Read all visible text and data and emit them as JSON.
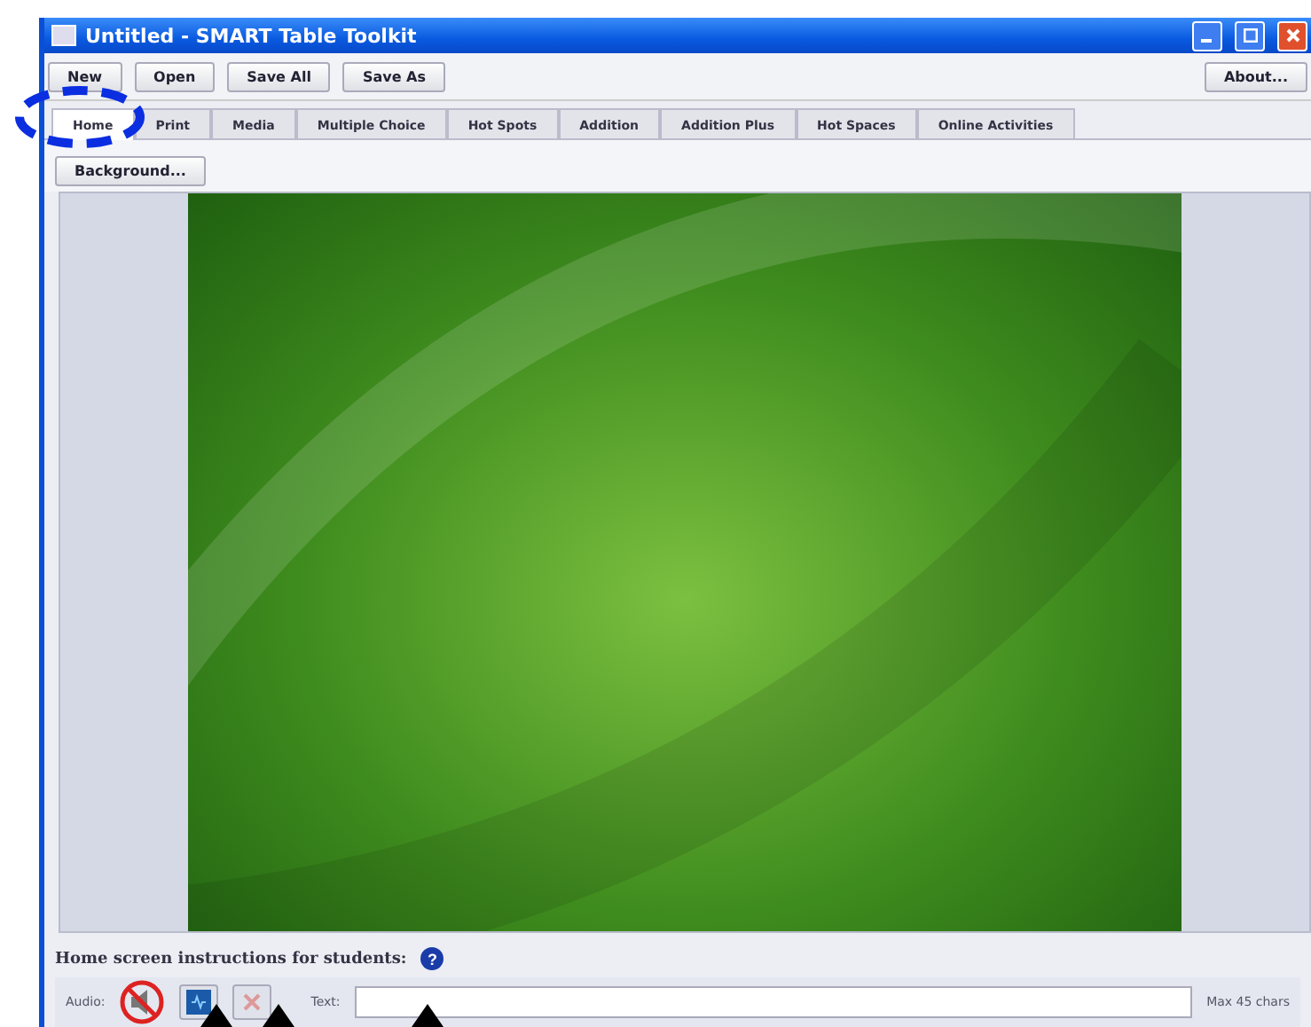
{
  "window": {
    "title": "Untitled - SMART Table Toolkit"
  },
  "toolbar": {
    "buttons": [
      "New",
      "Open",
      "Save All",
      "Save As"
    ],
    "about": "About..."
  },
  "tabs": [
    {
      "label": "Home",
      "selected": true
    },
    {
      "label": "Print",
      "selected": false
    },
    {
      "label": "Media",
      "selected": false
    },
    {
      "label": "Multiple Choice",
      "selected": false
    },
    {
      "label": "Hot Spots",
      "selected": false
    },
    {
      "label": "Addition",
      "selected": false
    },
    {
      "label": "Addition Plus",
      "selected": false
    },
    {
      "label": "Hot Spaces",
      "selected": false
    },
    {
      "label": "Online Activities",
      "selected": false
    }
  ],
  "background_button": "Background...",
  "instructions": {
    "heading": "Home screen instructions for students:",
    "help": "?",
    "audio_label": "Audio:",
    "muted": true,
    "text_label": "Text:",
    "limit": "Max 45 chars"
  }
}
